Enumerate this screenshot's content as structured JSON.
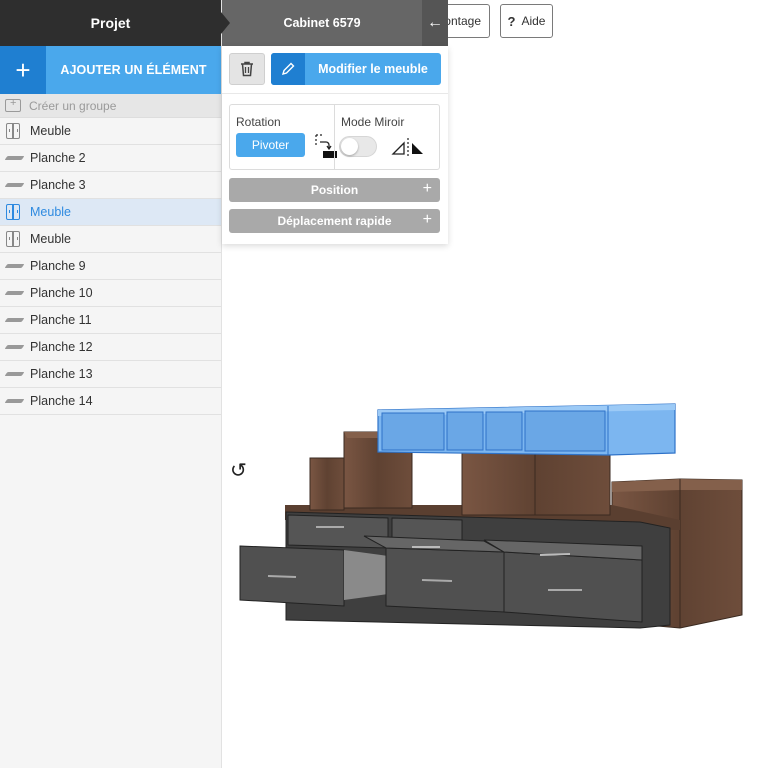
{
  "sidebar": {
    "project_title": "Projet",
    "add_plus": "+",
    "add_label": "AJOUTER UN ÉLÉMENT",
    "create_group": "Créer un groupe",
    "items": [
      {
        "label": "Meuble",
        "icon": "cabinet-icon"
      },
      {
        "label": "Planche 2",
        "icon": "board-icon"
      },
      {
        "label": "Planche 3",
        "icon": "board-icon"
      },
      {
        "label": "Meuble",
        "icon": "cabinet-icon",
        "selected": true
      },
      {
        "label": "Meuble",
        "icon": "cabinet-icon"
      },
      {
        "label": "Planche 9",
        "icon": "board-icon"
      },
      {
        "label": "Planche 10",
        "icon": "board-icon"
      },
      {
        "label": "Planche 11",
        "icon": "board-icon"
      },
      {
        "label": "Planche 12",
        "icon": "board-icon"
      },
      {
        "label": "Planche 13",
        "icon": "board-icon"
      },
      {
        "label": "Planche 14",
        "icon": "board-icon"
      }
    ]
  },
  "header": {
    "cabinet_title": "Cabinet 6579",
    "back_icon": "←",
    "montage_label": "ontage",
    "aide_icon": "?",
    "aide_label": "Aide"
  },
  "panel": {
    "modify_label": "Modifier le meuble",
    "rotation_title": "Rotation",
    "pivot_label": "Pivoter",
    "mirror_title": "Mode Miroir",
    "mirror_enabled": false,
    "position_label": "Position",
    "quick_move_label": "Déplacement rapide",
    "accordion_plus": "+"
  },
  "viewport": {
    "rotate_handle": "↺"
  },
  "colors": {
    "accent": "#4aa8ec",
    "accent_dark": "#1f7fd1",
    "header_dark": "#2e2e2e",
    "selected_cabinet": "#7cb6f0",
    "wood": "#6b4c3a",
    "drawer": "#4a4a4a"
  }
}
